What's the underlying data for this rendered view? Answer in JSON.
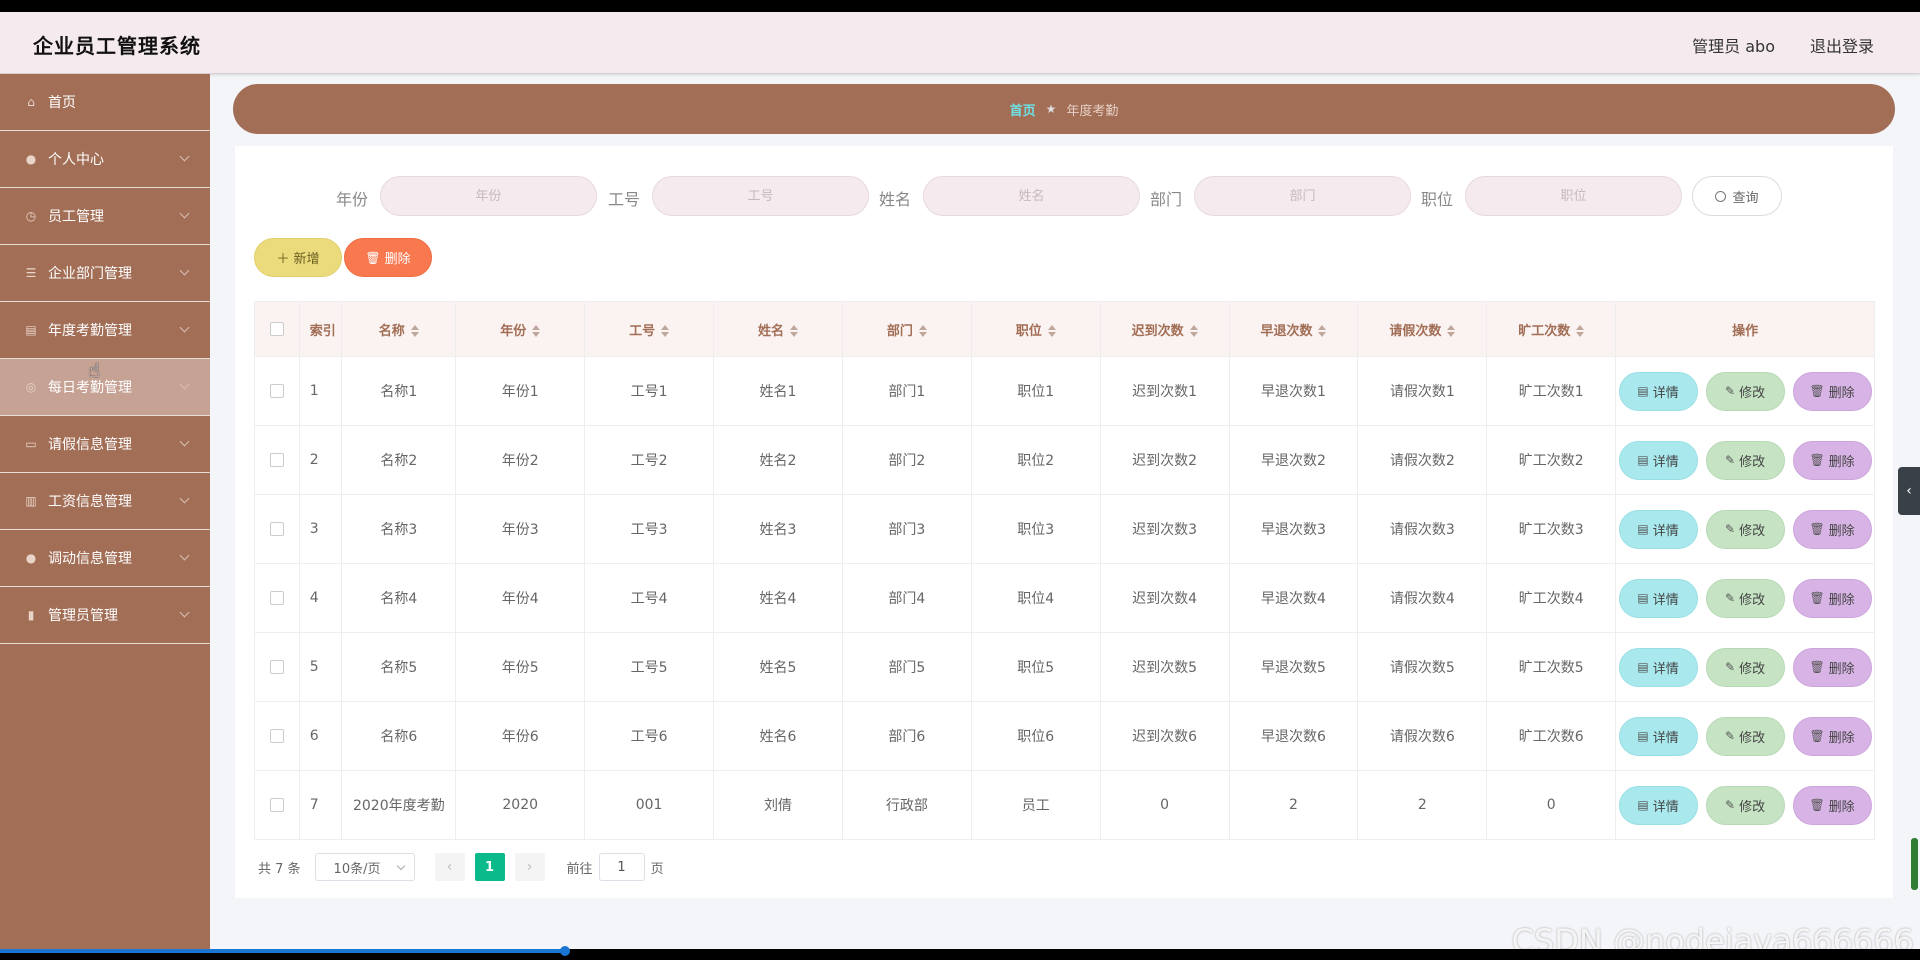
{
  "app": {
    "title": "企业员工管理系统"
  },
  "header": {
    "user": "管理员 abo",
    "logout": "退出登录"
  },
  "sidebar": {
    "items": [
      {
        "label": "首页",
        "icon": "home-icon",
        "has_submenu": false
      },
      {
        "label": "个人中心",
        "icon": "user-icon",
        "has_submenu": true
      },
      {
        "label": "员工管理",
        "icon": "clock-icon",
        "has_submenu": true
      },
      {
        "label": "企业部门管理",
        "icon": "list-icon",
        "has_submenu": true
      },
      {
        "label": "年度考勤管理",
        "icon": "briefcase-icon",
        "has_submenu": true
      },
      {
        "label": "每日考勤管理",
        "icon": "badge-icon",
        "has_submenu": true
      },
      {
        "label": "请假信息管理",
        "icon": "chat-icon",
        "has_submenu": true
      },
      {
        "label": "工资信息管理",
        "icon": "bar-chart-icon",
        "has_submenu": true
      },
      {
        "label": "调动信息管理",
        "icon": "user-icon",
        "has_submenu": true
      },
      {
        "label": "管理员管理",
        "icon": "book-icon",
        "has_submenu": true
      }
    ],
    "hovered_index": 5
  },
  "breadcrumb": {
    "home": "首页",
    "current": "年度考勤"
  },
  "search": {
    "fields": [
      {
        "label": "年份",
        "placeholder": "年份"
      },
      {
        "label": "工号",
        "placeholder": "工号"
      },
      {
        "label": "姓名",
        "placeholder": "姓名"
      },
      {
        "label": "部门",
        "placeholder": "部门"
      },
      {
        "label": "职位",
        "placeholder": "职位"
      }
    ],
    "query_label": "查询"
  },
  "actions": {
    "add_label": "新增",
    "delete_label": "删除"
  },
  "table": {
    "columns": [
      "索引",
      "名称",
      "年份",
      "工号",
      "姓名",
      "部门",
      "职位",
      "迟到次数",
      "早退次数",
      "请假次数",
      "旷工次数",
      "操作"
    ],
    "rows": [
      [
        "1",
        "名称1",
        "年份1",
        "工号1",
        "姓名1",
        "部门1",
        "职位1",
        "迟到次数1",
        "早退次数1",
        "请假次数1",
        "旷工次数1"
      ],
      [
        "2",
        "名称2",
        "年份2",
        "工号2",
        "姓名2",
        "部门2",
        "职位2",
        "迟到次数2",
        "早退次数2",
        "请假次数2",
        "旷工次数2"
      ],
      [
        "3",
        "名称3",
        "年份3",
        "工号3",
        "姓名3",
        "部门3",
        "职位3",
        "迟到次数3",
        "早退次数3",
        "请假次数3",
        "旷工次数3"
      ],
      [
        "4",
        "名称4",
        "年份4",
        "工号4",
        "姓名4",
        "部门4",
        "职位4",
        "迟到次数4",
        "早退次数4",
        "请假次数4",
        "旷工次数4"
      ],
      [
        "5",
        "名称5",
        "年份5",
        "工号5",
        "姓名5",
        "部门5",
        "职位5",
        "迟到次数5",
        "早退次数5",
        "请假次数5",
        "旷工次数5"
      ],
      [
        "6",
        "名称6",
        "年份6",
        "工号6",
        "姓名6",
        "部门6",
        "职位6",
        "迟到次数6",
        "早退次数6",
        "请假次数6",
        "旷工次数6"
      ],
      [
        "7",
        "2020年度考勤",
        "2020",
        "001",
        "刘倩",
        "行政部",
        "员工",
        "0",
        "2",
        "2",
        "0"
      ]
    ],
    "row_actions": {
      "detail": "详情",
      "edit": "修改",
      "delete": "删除"
    }
  },
  "pagination": {
    "total": "共 7 条",
    "page_size": "10条/页",
    "current_page": "1",
    "goto_prefix": "前往",
    "goto_value": "1",
    "goto_suffix": "页"
  },
  "watermark": "CSDN @nodejava666666",
  "colors": {
    "sidebar_bg": "#a26e56",
    "header_bg": "#f5ebee",
    "breadcrumb_home": "#6fe0e5",
    "add_button": "#ebdb7d",
    "delete_button": "#f8794f",
    "detail_button": "#a9e9ee",
    "edit_button": "#c6e4c4",
    "row_delete_button": "#d8b4e6",
    "page_active": "#0bba8a"
  }
}
